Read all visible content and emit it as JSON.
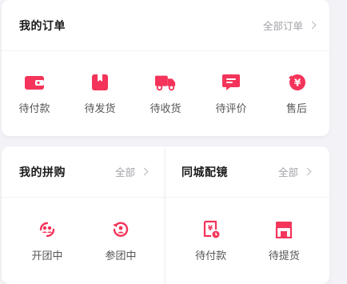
{
  "accent": "#f4345a",
  "orders": {
    "title": "我的订单",
    "more": "全部订单",
    "items": [
      {
        "label": "待付款",
        "icon": "wallet-icon"
      },
      {
        "label": "待发货",
        "icon": "package-icon"
      },
      {
        "label": "待收货",
        "icon": "truck-icon"
      },
      {
        "label": "待评价",
        "icon": "review-icon"
      },
      {
        "label": "售后",
        "icon": "after-sale-icon"
      }
    ]
  },
  "group": {
    "title": "我的拼购",
    "more": "全部",
    "items": [
      {
        "label": "开团中",
        "icon": "group-open-icon"
      },
      {
        "label": "参团中",
        "icon": "group-join-icon"
      }
    ]
  },
  "city": {
    "title": "同城配镜",
    "more": "全部",
    "items": [
      {
        "label": "待付款",
        "icon": "pay-receipt-icon"
      },
      {
        "label": "待提货",
        "icon": "store-icon"
      }
    ]
  }
}
